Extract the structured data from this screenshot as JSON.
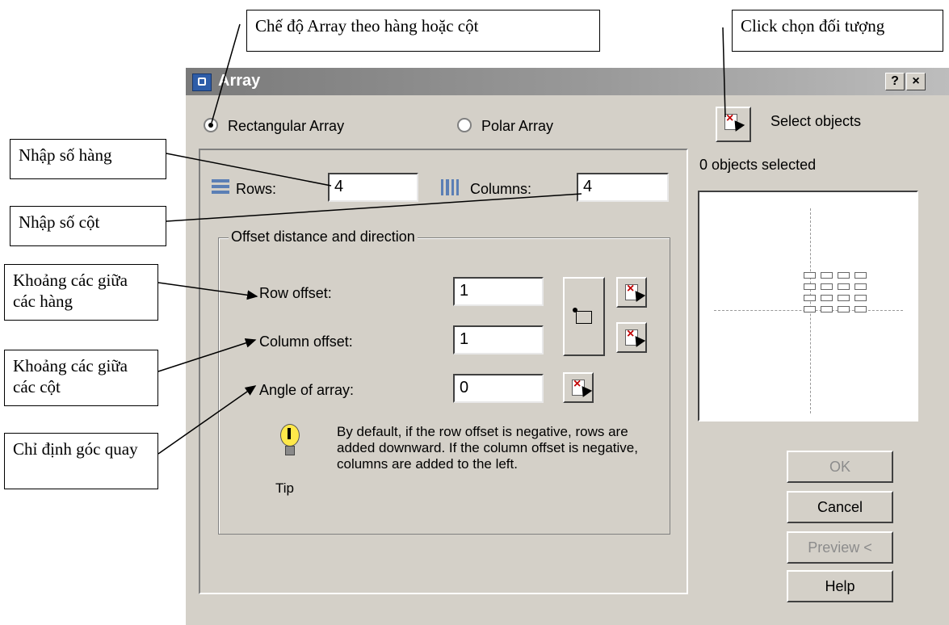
{
  "callouts": {
    "array_mode": "Chế độ Array theo hàng hoặc cột",
    "select_objects": "Click chọn đối tượng",
    "rows": "Nhập số hàng",
    "columns": "Nhập số cột",
    "row_offset": "Khoảng các giữa các hàng",
    "column_offset": "Khoảng các giữa các cột",
    "angle": "Chỉ định góc quay"
  },
  "dialog": {
    "title": "Array",
    "help_button": "?",
    "close_button": "×",
    "rectangular_label": "Rectangular Array",
    "polar_label": "Polar Array",
    "selected_mode": "rectangular",
    "select_objects_label": "Select objects",
    "objects_selected": "0 objects selected",
    "rows_label": "Rows:",
    "rows_value": "4",
    "columns_label": "Columns:",
    "columns_value": "4",
    "offset_group": "Offset distance and direction",
    "row_offset_label": "Row offset:",
    "row_offset_value": "1",
    "column_offset_label": "Column offset:",
    "column_offset_value": "1",
    "angle_label": "Angle of array:",
    "angle_value": "0",
    "tip_text": "By default, if the row offset is negative, rows are added downward.  If the column offset is negative, columns are added to the left.",
    "tip_label": "Tip",
    "buttons": {
      "ok": "OK",
      "cancel": "Cancel",
      "preview": "Preview <",
      "help": "Help"
    }
  },
  "colors": {
    "dialog_bg": "#d4d0c8",
    "title_gradient_start": "#7a7a7a",
    "disabled_text": "#8c8c8c"
  }
}
